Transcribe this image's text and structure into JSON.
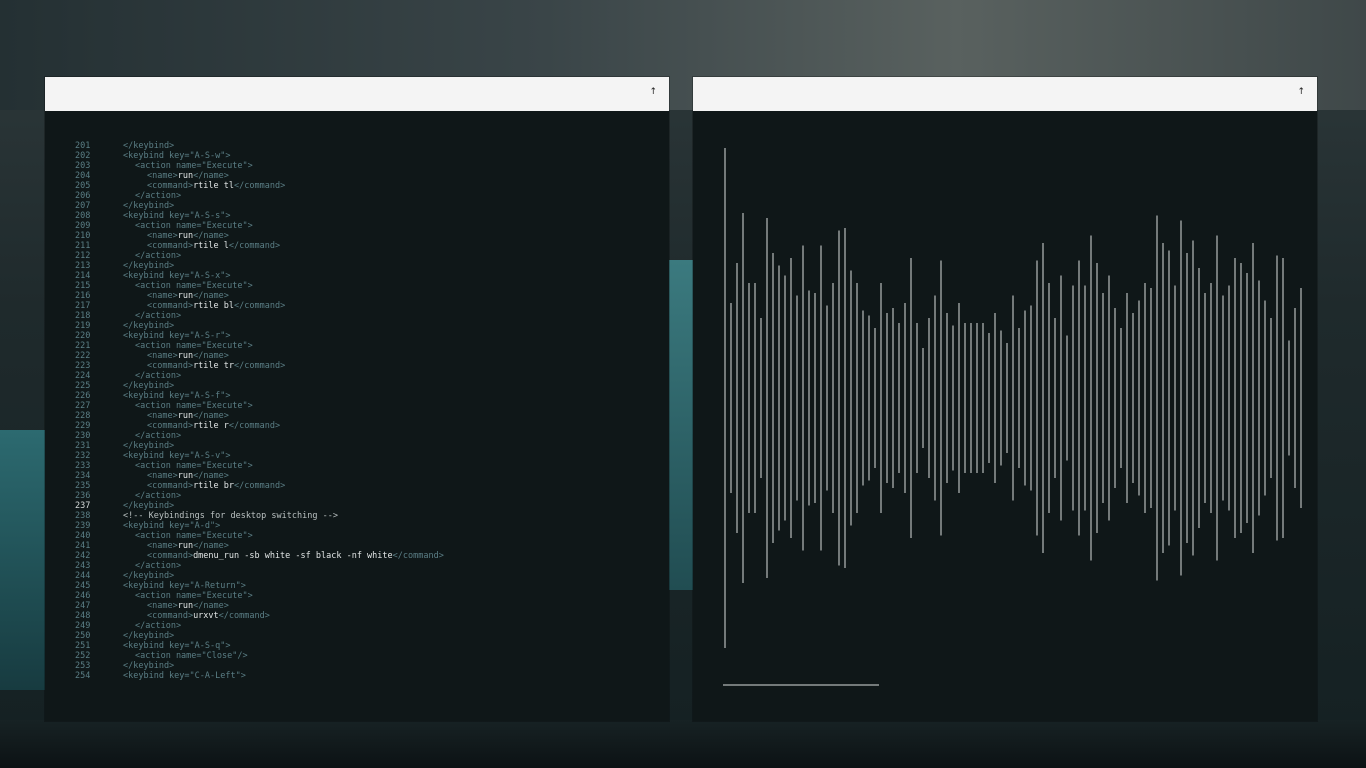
{
  "left_window": {
    "titlebar_button": "↑",
    "current_line": 237,
    "lines": [
      {
        "n": 201,
        "indent": 0,
        "parts": [
          [
            "tag",
            "</keybind>"
          ]
        ]
      },
      {
        "n": 202,
        "indent": 0,
        "parts": [
          [
            "tag",
            "<keybind key=\"A-S-w\">"
          ]
        ]
      },
      {
        "n": 203,
        "indent": 2,
        "parts": [
          [
            "tag",
            "<action name=\"Execute\">"
          ]
        ]
      },
      {
        "n": 204,
        "indent": 4,
        "parts": [
          [
            "tag",
            "<name>"
          ],
          [
            "txt",
            "run"
          ],
          [
            "tag",
            "</name>"
          ]
        ]
      },
      {
        "n": 205,
        "indent": 4,
        "parts": [
          [
            "tag",
            "<command>"
          ],
          [
            "txt",
            "rtile tl"
          ],
          [
            "tag",
            "</command>"
          ]
        ]
      },
      {
        "n": 206,
        "indent": 2,
        "parts": [
          [
            "tag",
            "</action>"
          ]
        ]
      },
      {
        "n": 207,
        "indent": 0,
        "parts": [
          [
            "tag",
            "</keybind>"
          ]
        ]
      },
      {
        "n": 208,
        "indent": 0,
        "parts": [
          [
            "tag",
            "<keybind key=\"A-S-s\">"
          ]
        ]
      },
      {
        "n": 209,
        "indent": 2,
        "parts": [
          [
            "tag",
            "<action name=\"Execute\">"
          ]
        ]
      },
      {
        "n": 210,
        "indent": 4,
        "parts": [
          [
            "tag",
            "<name>"
          ],
          [
            "txt",
            "run"
          ],
          [
            "tag",
            "</name>"
          ]
        ]
      },
      {
        "n": 211,
        "indent": 4,
        "parts": [
          [
            "tag",
            "<command>"
          ],
          [
            "txt",
            "rtile l"
          ],
          [
            "tag",
            "</command>"
          ]
        ]
      },
      {
        "n": 212,
        "indent": 2,
        "parts": [
          [
            "tag",
            "</action>"
          ]
        ]
      },
      {
        "n": 213,
        "indent": 0,
        "parts": [
          [
            "tag",
            "</keybind>"
          ]
        ]
      },
      {
        "n": 214,
        "indent": 0,
        "parts": [
          [
            "tag",
            "<keybind key=\"A-S-x\">"
          ]
        ]
      },
      {
        "n": 215,
        "indent": 2,
        "parts": [
          [
            "tag",
            "<action name=\"Execute\">"
          ]
        ]
      },
      {
        "n": 216,
        "indent": 4,
        "parts": [
          [
            "tag",
            "<name>"
          ],
          [
            "txt",
            "run"
          ],
          [
            "tag",
            "</name>"
          ]
        ]
      },
      {
        "n": 217,
        "indent": 4,
        "parts": [
          [
            "tag",
            "<command>"
          ],
          [
            "txt",
            "rtile bl"
          ],
          [
            "tag",
            "</command>"
          ]
        ]
      },
      {
        "n": 218,
        "indent": 2,
        "parts": [
          [
            "tag",
            "</action>"
          ]
        ]
      },
      {
        "n": 219,
        "indent": 0,
        "parts": [
          [
            "tag",
            "</keybind>"
          ]
        ]
      },
      {
        "n": 220,
        "indent": 0,
        "parts": [
          [
            "tag",
            "<keybind key=\"A-S-r\">"
          ]
        ]
      },
      {
        "n": 221,
        "indent": 2,
        "parts": [
          [
            "tag",
            "<action name=\"Execute\">"
          ]
        ]
      },
      {
        "n": 222,
        "indent": 4,
        "parts": [
          [
            "tag",
            "<name>"
          ],
          [
            "txt",
            "run"
          ],
          [
            "tag",
            "</name>"
          ]
        ]
      },
      {
        "n": 223,
        "indent": 4,
        "parts": [
          [
            "tag",
            "<command>"
          ],
          [
            "txt",
            "rtile tr"
          ],
          [
            "tag",
            "</command>"
          ]
        ]
      },
      {
        "n": 224,
        "indent": 2,
        "parts": [
          [
            "tag",
            "</action>"
          ]
        ]
      },
      {
        "n": 225,
        "indent": 0,
        "parts": [
          [
            "tag",
            "</keybind>"
          ]
        ]
      },
      {
        "n": 226,
        "indent": 0,
        "parts": [
          [
            "tag",
            "<keybind key=\"A-S-f\">"
          ]
        ]
      },
      {
        "n": 227,
        "indent": 2,
        "parts": [
          [
            "tag",
            "<action name=\"Execute\">"
          ]
        ]
      },
      {
        "n": 228,
        "indent": 4,
        "parts": [
          [
            "tag",
            "<name>"
          ],
          [
            "txt",
            "run"
          ],
          [
            "tag",
            "</name>"
          ]
        ]
      },
      {
        "n": 229,
        "indent": 4,
        "parts": [
          [
            "tag",
            "<command>"
          ],
          [
            "txt",
            "rtile r"
          ],
          [
            "tag",
            "</command>"
          ]
        ]
      },
      {
        "n": 230,
        "indent": 2,
        "parts": [
          [
            "tag",
            "</action>"
          ]
        ]
      },
      {
        "n": 231,
        "indent": 0,
        "parts": [
          [
            "tag",
            "</keybind>"
          ]
        ]
      },
      {
        "n": 232,
        "indent": 0,
        "parts": [
          [
            "tag",
            "<keybind key=\"A-S-v\">"
          ]
        ]
      },
      {
        "n": 233,
        "indent": 2,
        "parts": [
          [
            "tag",
            "<action name=\"Execute\">"
          ]
        ]
      },
      {
        "n": 234,
        "indent": 4,
        "parts": [
          [
            "tag",
            "<name>"
          ],
          [
            "txt",
            "run"
          ],
          [
            "tag",
            "</name>"
          ]
        ]
      },
      {
        "n": 235,
        "indent": 4,
        "parts": [
          [
            "tag",
            "<command>"
          ],
          [
            "txt",
            "rtile br"
          ],
          [
            "tag",
            "</command>"
          ]
        ]
      },
      {
        "n": 236,
        "indent": 2,
        "parts": [
          [
            "tag",
            "</action>"
          ]
        ]
      },
      {
        "n": 237,
        "indent": 0,
        "parts": [
          [
            "tag",
            "</keybind>"
          ]
        ]
      },
      {
        "n": 238,
        "indent": 0,
        "parts": [
          [
            "cmt",
            "<!-- Keybindings for desktop switching -->"
          ]
        ]
      },
      {
        "n": 239,
        "indent": 0,
        "parts": [
          [
            "tag",
            "<keybind key=\"A-d\">"
          ]
        ]
      },
      {
        "n": 240,
        "indent": 2,
        "parts": [
          [
            "tag",
            "<action name=\"Execute\">"
          ]
        ]
      },
      {
        "n": 241,
        "indent": 4,
        "parts": [
          [
            "tag",
            "<name>"
          ],
          [
            "txt",
            "run"
          ],
          [
            "tag",
            "</name>"
          ]
        ]
      },
      {
        "n": 242,
        "indent": 4,
        "parts": [
          [
            "tag",
            "<command>"
          ],
          [
            "txt",
            "dmenu_run -sb white -sf black -nf white"
          ],
          [
            "tag",
            "</command>"
          ]
        ]
      },
      {
        "n": 243,
        "indent": 2,
        "parts": [
          [
            "tag",
            "</action>"
          ]
        ]
      },
      {
        "n": 244,
        "indent": 0,
        "parts": [
          [
            "tag",
            "</keybind>"
          ]
        ]
      },
      {
        "n": 245,
        "indent": 0,
        "parts": [
          [
            "tag",
            "<keybind key=\"A-Return\">"
          ]
        ]
      },
      {
        "n": 246,
        "indent": 2,
        "parts": [
          [
            "tag",
            "<action name=\"Execute\">"
          ]
        ]
      },
      {
        "n": 247,
        "indent": 4,
        "parts": [
          [
            "tag",
            "<name>"
          ],
          [
            "txt",
            "run"
          ],
          [
            "tag",
            "</name>"
          ]
        ]
      },
      {
        "n": 248,
        "indent": 4,
        "parts": [
          [
            "tag",
            "<command>"
          ],
          [
            "txt",
            "urxvt"
          ],
          [
            "tag",
            "</command>"
          ]
        ]
      },
      {
        "n": 249,
        "indent": 2,
        "parts": [
          [
            "tag",
            "</action>"
          ]
        ]
      },
      {
        "n": 250,
        "indent": 0,
        "parts": [
          [
            "tag",
            "</keybind>"
          ]
        ]
      },
      {
        "n": 251,
        "indent": 0,
        "parts": [
          [
            "tag",
            "<keybind key=\"A-S-q\">"
          ]
        ]
      },
      {
        "n": 252,
        "indent": 2,
        "parts": [
          [
            "tag",
            "<action name=\"Close\"/>"
          ]
        ]
      },
      {
        "n": 253,
        "indent": 0,
        "parts": [
          [
            "tag",
            "</keybind>"
          ]
        ]
      },
      {
        "n": 254,
        "indent": 0,
        "parts": [
          [
            "tag",
            "<keybind key=\"C-A-Left\">"
          ]
        ]
      }
    ]
  },
  "right_window": {
    "titlebar_button": "↑",
    "visualizer": {
      "line_color": "#d8dcdc",
      "progress": 0.26,
      "bar_levels": [
        1.0,
        0.38,
        0.54,
        0.74,
        0.46,
        0.46,
        0.32,
        0.72,
        0.58,
        0.53,
        0.49,
        0.56,
        0.41,
        0.61,
        0.43,
        0.42,
        0.61,
        0.37,
        0.46,
        0.67,
        0.68,
        0.51,
        0.46,
        0.35,
        0.33,
        0.28,
        0.46,
        0.34,
        0.36,
        0.3,
        0.38,
        0.56,
        0.3,
        0.2,
        0.32,
        0.41,
        0.55,
        0.34,
        0.29,
        0.38,
        0.3,
        0.3,
        0.3,
        0.3,
        0.26,
        0.34,
        0.27,
        0.22,
        0.41,
        0.28,
        0.35,
        0.37,
        0.55,
        0.62,
        0.46,
        0.32,
        0.49,
        0.25,
        0.45,
        0.55,
        0.45,
        0.65,
        0.54,
        0.42,
        0.49,
        0.36,
        0.28,
        0.42,
        0.34,
        0.39,
        0.46,
        0.44,
        0.73,
        0.62,
        0.59,
        0.45,
        0.71,
        0.58,
        0.63,
        0.52,
        0.42,
        0.46,
        0.65,
        0.41,
        0.45,
        0.56,
        0.54,
        0.5,
        0.62,
        0.47,
        0.39,
        0.32,
        0.57,
        0.56,
        0.23,
        0.36,
        0.44
      ]
    }
  }
}
